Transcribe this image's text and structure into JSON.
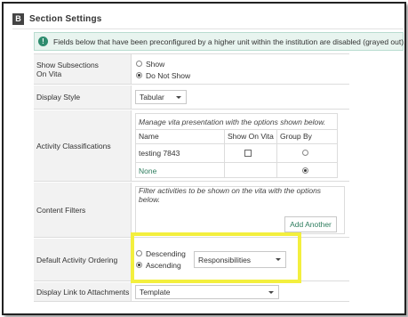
{
  "section": {
    "badge": "B",
    "title": "Section Settings"
  },
  "notice": {
    "icon": "!",
    "text": "Fields below that have been preconfigured by a higher unit within the institution are disabled (grayed out)."
  },
  "rows": {
    "show_subsections": {
      "label_line1": "Show Subsections",
      "label_line2": "On Vita",
      "options": [
        {
          "label": "Show",
          "selected": false
        },
        {
          "label": "Do Not Show",
          "selected": true
        }
      ]
    },
    "display_style": {
      "label": "Display Style",
      "value": "Tabular"
    },
    "activity_classifications": {
      "label": "Activity Classifications",
      "caption": "Manage vita presentation with the options shown below.",
      "columns": [
        "Name",
        "Show On Vita",
        "Group By"
      ],
      "rows": [
        {
          "name": "testing 7843",
          "show_on_vita": false,
          "group_by": false
        },
        {
          "name": "None",
          "show_on_vita": null,
          "group_by": true
        }
      ]
    },
    "content_filters": {
      "label": "Content Filters",
      "caption": "Filter activities to be shown on the vita with the options below.",
      "button": "Add Another"
    },
    "default_ordering": {
      "label": "Default Activity Ordering",
      "options": [
        {
          "label": "Descending",
          "selected": false
        },
        {
          "label": "Ascending",
          "selected": true
        }
      ],
      "field_value": "Responsibilities"
    },
    "display_link": {
      "label": "Display Link to Attachments",
      "value": "Template"
    }
  },
  "colors": {
    "highlight": "#f3ef3e",
    "link": "#2e7d5e",
    "notice_bg": "#e8f4ef"
  }
}
